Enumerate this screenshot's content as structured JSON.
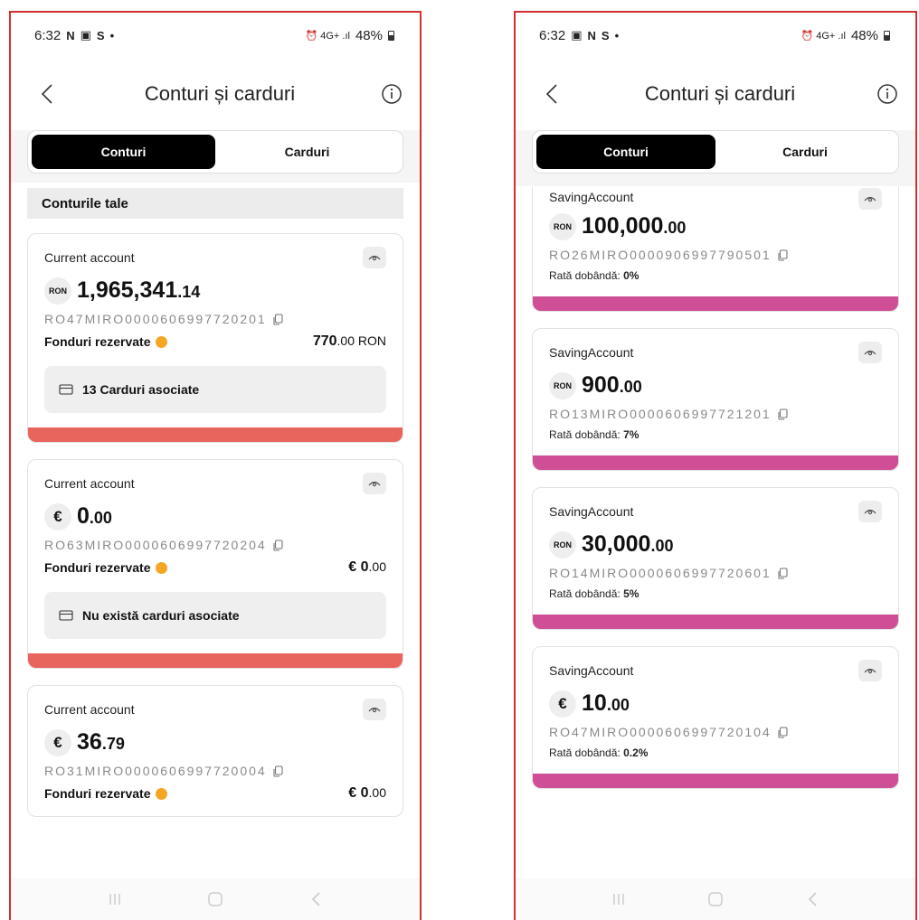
{
  "left": {
    "status": {
      "time": "6:32",
      "glyphs": [
        "N",
        "▣",
        "S",
        "•"
      ],
      "battery": "48%",
      "signal": "⏰ 4G+ .ıl"
    },
    "header": {
      "title": "Conturi și carduri"
    },
    "tabs": {
      "active": "Conturi",
      "inactive": "Carduri"
    },
    "section_title": "Conturile tale",
    "accounts": [
      {
        "type": "Current account",
        "currency": "RON",
        "amount_int": "1,965,341",
        "amount_dec": ".14",
        "iban": "RO47MIRO0000606997720201",
        "funds_label": "Fonduri rezervate",
        "funds_value_main": "770",
        "funds_value_dec": ".00 RON",
        "assoc": "13 Carduri asociate"
      },
      {
        "type": "Current account",
        "currency": "€",
        "amount_int": "0",
        "amount_dec": ".00",
        "iban": "RO63MIRO0000606997720204",
        "funds_label": "Fonduri rezervate",
        "funds_value_main": "€ 0",
        "funds_value_dec": ".00",
        "assoc": "Nu există carduri asociate"
      },
      {
        "type": "Current account",
        "currency": "€",
        "amount_int": "36",
        "amount_dec": ".79",
        "iban": "RO31MIRO0000606997720004",
        "funds_label": "Fonduri rezervate",
        "funds_value_main": "€ 0",
        "funds_value_dec": ".00"
      }
    ]
  },
  "right": {
    "status": {
      "time": "6:32",
      "glyphs": [
        "▣",
        "N",
        "S",
        "•"
      ],
      "battery": "48%",
      "signal": "⏰ 4G+ .ıl"
    },
    "header": {
      "title": "Conturi și carduri"
    },
    "tabs": {
      "active": "Conturi",
      "inactive": "Carduri"
    },
    "rate_label": "Rată dobândă:",
    "accounts": [
      {
        "type": "SavingAccount",
        "currency": "RON",
        "amount_int": "100,000",
        "amount_dec": ".00",
        "iban": "RO26MIRO0000906997790501",
        "rate": "0%"
      },
      {
        "type": "SavingAccount",
        "currency": "RON",
        "amount_int": "900",
        "amount_dec": ".00",
        "iban": "RO13MIRO0000606997721201",
        "rate": "7%"
      },
      {
        "type": "SavingAccount",
        "currency": "RON",
        "amount_int": "30,000",
        "amount_dec": ".00",
        "iban": "RO14MIRO0000606997720601",
        "rate": "5%"
      },
      {
        "type": "SavingAccount",
        "currency": "€",
        "amount_int": "10",
        "amount_dec": ".00",
        "iban": "RO47MIRO0000606997720104",
        "rate": "0.2%"
      }
    ]
  },
  "colors": {
    "accent_current": "#e8655e",
    "accent_saving": "#cf4f96",
    "warning": "#f5a623",
    "frame": "#d32f2f"
  },
  "icons": [
    "back-arrow-icon",
    "info-icon",
    "eye-icon",
    "copy-icon",
    "card-icon",
    "warning-icon",
    "recents-icon",
    "home-icon",
    "back-nav-icon"
  ]
}
